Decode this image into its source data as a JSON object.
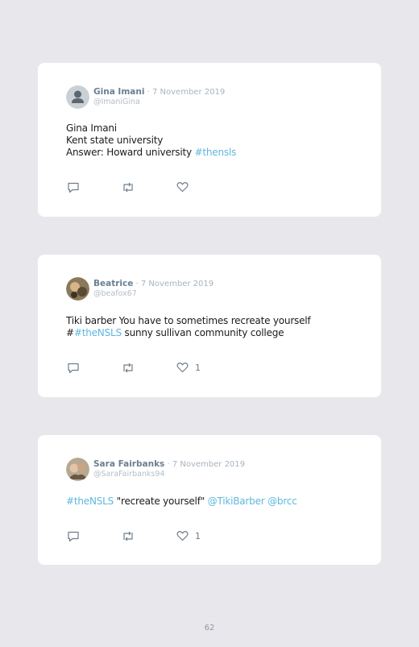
{
  "tweets": [
    {
      "name": "Gina Imani",
      "date": " · 7 November 2019",
      "handle": "@ImaniGina",
      "lines": [
        {
          "text": "Gina Imani",
          "link": ""
        },
        {
          "text": "Kent state university",
          "link": ""
        },
        {
          "text": "Answer: Howard university ",
          "link": "#thensls"
        }
      ],
      "likes": ""
    },
    {
      "name": "Beatrice",
      "date": " · 7 November 2019",
      "handle": "@beafox67",
      "line1": "Tiki barber You have to sometimes recreate yourself",
      "line2_prefix": "#",
      "line2_link": "#theNSLS",
      "line2_rest": " sunny sullivan community college",
      "likes": "1"
    },
    {
      "name": "Sara Fairbanks",
      "date": " · 7 November 2019",
      "handle": "@SaraFairbanks94",
      "link1": "#theNSLS",
      "middle": " \"recreate yourself\" ",
      "link2": "@TikiBarber",
      "space": " ",
      "link3": "@brcc",
      "likes": "1"
    }
  ],
  "page_number": "62",
  "colors": {
    "background": "#e8e8ec",
    "card": "#ffffff",
    "link": "#5eb7de",
    "name": "#6b7f92",
    "muted": "#a7b3bf"
  },
  "icons": [
    "reply-icon",
    "retweet-icon",
    "like-icon"
  ]
}
